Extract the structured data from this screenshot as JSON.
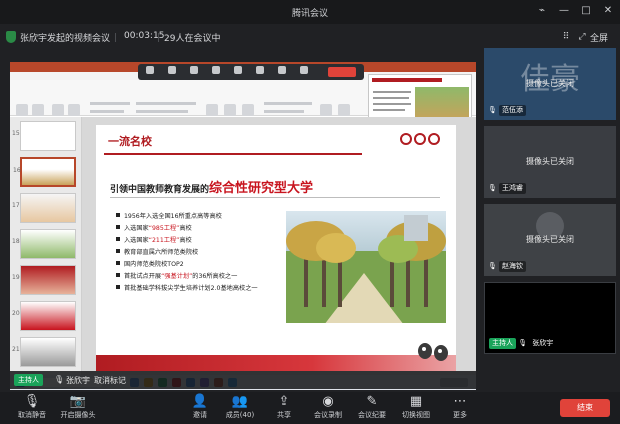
{
  "window": {
    "title": "腾讯会议"
  },
  "infobar": {
    "meeting_title": "张欣宇发起的视频会议",
    "timer": "00:03:15",
    "participants_in_meeting": "29人在会议中",
    "fullscreen_label": "全屏"
  },
  "slide": {
    "heading": "一流名校",
    "subtitle_prefix": "引领中国教师教育发展的",
    "subtitle_highlight": "综合性研究型大学",
    "bullets": [
      {
        "pre": "1956年入选全国16所重点高等高校",
        "hl": "",
        "post": ""
      },
      {
        "pre": "入选国家",
        "hl": "“985工程”",
        "post": "高校"
      },
      {
        "pre": "入选国家",
        "hl": "“211工程”",
        "post": "高校"
      },
      {
        "pre": "教育部直属六所师范类院校",
        "hl": "",
        "post": ""
      },
      {
        "pre": "国内师范类院校TOP2",
        "hl": "",
        "post": ""
      },
      {
        "pre": "首批试点开展",
        "hl": "“强基计划”",
        "post": "的36所高校之一"
      },
      {
        "pre": "首批基础学科拔尖学生培养计划2.0基地高校之一",
        "hl": "",
        "post": ""
      }
    ]
  },
  "host": {
    "badge": "主持人",
    "name": "张欣宇",
    "cancel_label": "取消标记"
  },
  "participants": [
    {
      "name": "范伍添",
      "camera_off_text": "摄像头已关闭",
      "large_name": "佳豪",
      "bg": "#2b4a6a"
    },
    {
      "name": "王鸿睿",
      "camera_off_text": "摄像头已关闭",
      "large_name": "",
      "bg": "#3a3d42"
    },
    {
      "name": "赵海钦",
      "camera_off_text": "摄像头已关闭",
      "large_name": "",
      "bg": "#3f4246"
    },
    {
      "name": "张欣宇",
      "badge": "主持人",
      "camera_off_text": "",
      "large_name": "",
      "bg": "#000000"
    }
  ],
  "toolbar": {
    "items": [
      {
        "label": "取消静音",
        "icon": "microphone-icon"
      },
      {
        "label": "开启摄像头",
        "icon": "camera-icon"
      },
      {
        "label": "邀请",
        "icon": "add-user-icon"
      },
      {
        "label": "成员(40)",
        "icon": "members-icon"
      },
      {
        "label": "共享",
        "icon": "share-screen-icon"
      },
      {
        "label": "会议录制",
        "icon": "record-icon"
      },
      {
        "label": "会议纪要",
        "icon": "notes-icon"
      },
      {
        "label": "切换视图",
        "icon": "view-icon"
      },
      {
        "label": "更多",
        "icon": "more-icon"
      }
    ],
    "leave_label": "结束"
  },
  "colors": {
    "accent_red": "#e0433a",
    "host_green": "#1aa35a",
    "slide_red": "#b01c21"
  }
}
